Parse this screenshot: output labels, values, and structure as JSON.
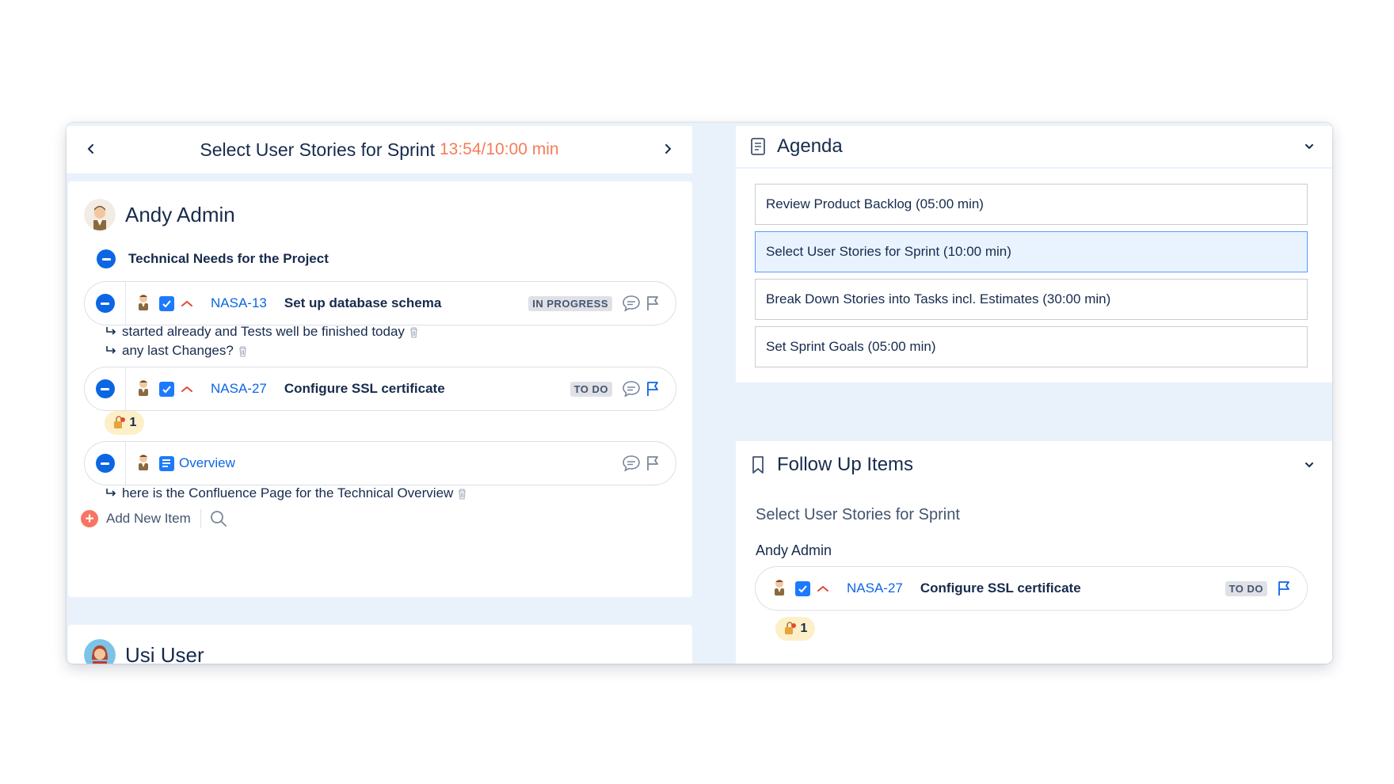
{
  "topic": {
    "title": "Select User Stories for Sprint",
    "timer": "13:54/10:00 min"
  },
  "user_section": {
    "user_name": "Andy Admin",
    "topic_label": "Technical Needs for the Project",
    "items": [
      {
        "key": "NASA-13",
        "summary": "Set up database schema",
        "status": "IN PROGRESS",
        "comments": [
          "started already and Tests well be finished today",
          "any last Changes?"
        ]
      },
      {
        "key": "NASA-27",
        "summary": "Configure SSL certificate",
        "status": "TO DO",
        "reaction_count": "1"
      }
    ],
    "doc_item": {
      "title": "Overview",
      "comment": "here is the Confluence Page for the Technical Overview"
    },
    "add_label": "Add New Item"
  },
  "second_user": {
    "user_name": "Usi User"
  },
  "agenda": {
    "title": "Agenda",
    "items": [
      "Review Product Backlog (05:00 min)",
      "Select User Stories for Sprint (10:00 min)",
      "Break Down Stories into Tasks incl. Estimates (30:00 min)",
      "Set Sprint Goals (05:00 min)"
    ]
  },
  "follow_up": {
    "title": "Follow Up Items",
    "topic": "Select User Stories for Sprint",
    "user_name": "Andy Admin",
    "item": {
      "key": "NASA-27",
      "summary": "Configure SSL certificate",
      "status": "TO DO",
      "reaction_count": "1"
    }
  },
  "colors": {
    "accent": "#0c66e4",
    "timer": "#f57c5b",
    "add": "#f87462",
    "reaction_bg": "#fdefc8",
    "active_agenda_bg": "#e9f2ff"
  }
}
